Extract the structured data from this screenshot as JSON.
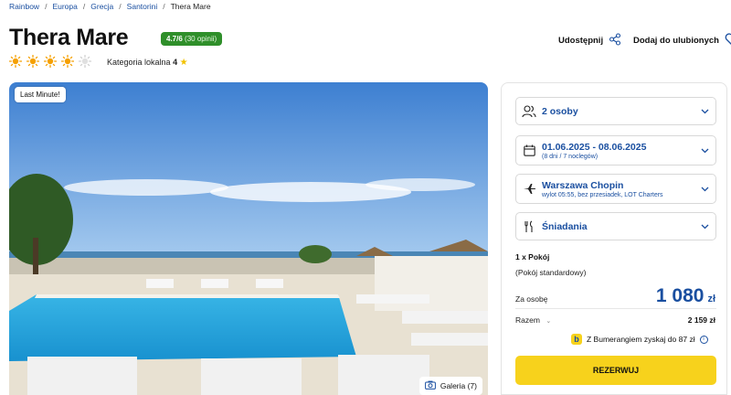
{
  "breadcrumb": [
    {
      "label": "Rainbow"
    },
    {
      "label": "Europa"
    },
    {
      "label": "Grecja"
    },
    {
      "label": "Santorini"
    },
    {
      "label": "Thera Mare"
    }
  ],
  "hotel": {
    "name": "Thera Mare",
    "rating": "4.7/6",
    "reviews": "(30 opinii)",
    "suns_total": 5,
    "suns_filled": 4,
    "category_label": "Kategoria lokalna",
    "category_value": "4"
  },
  "actions": {
    "share_label": "Udostępnij",
    "favorite_label": "Dodaj do ulubionych"
  },
  "gallery": {
    "badge": "Last Minute!",
    "gallery_label": "Galeria (7)"
  },
  "booking": {
    "persons": "2 osoby",
    "dates": "01.06.2025 - 08.06.2025",
    "dates_sub": "(8 dni / 7 noclegów)",
    "departure": "Warszawa Chopin",
    "departure_sub": "wylot 05:55, bez przesiadek, LOT Charters",
    "board": "Śniadania",
    "room_count": "1 x Pokój",
    "room_type": "(Pokój standardowy)",
    "per_person_label": "Za osobę",
    "per_person_price": "1 080",
    "currency": "zł",
    "total_label": "Razem",
    "total_value": "2 159 zł",
    "boomerang_text": "Z Bumerangiem zyskaj do 87 zł",
    "reserve_label": "REZERWUJ"
  },
  "colors": {
    "accent_blue": "#1a4fa0",
    "rating_green": "#2f8f2a",
    "reserve_yellow": "#f7d21c",
    "sun_orange": "#f5a000"
  }
}
